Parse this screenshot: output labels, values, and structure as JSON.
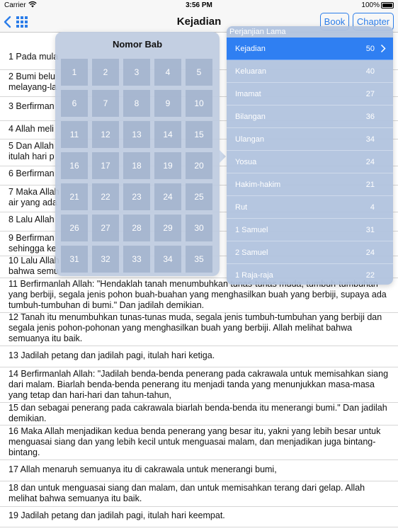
{
  "status": {
    "carrier": "Carrier",
    "time": "3:56 PM",
    "battery": "100%"
  },
  "nav": {
    "title": "Kejadian",
    "book_label": "Book",
    "chapter_label": "Chapter"
  },
  "verses": [
    {
      "text": "1 Pada mula"
    },
    {
      "text": "2 Bumi belu\nmelayang-la"
    },
    {
      "text": "3 Berfirman"
    },
    {
      "text": "4 Allah meli"
    },
    {
      "text": "5 Dan Allah\nitulah hari p"
    },
    {
      "text": "6 Berfirman"
    },
    {
      "text": "7 Maka Allah\nair yang ada"
    },
    {
      "text": "8 Lalu Allah"
    },
    {
      "text": "9 Berfirman\nsehingga ke"
    },
    {
      "text": "10 Lalu Allah\nbahwa semu"
    },
    {
      "text": "11 Berfirmanlah Allah: \"Hendaklah tanah menumbuhkan tunas-tunas muda, tumbuh-tumbuhan yang berbiji, segala jenis pohon buah-buahan yang menghasilkan buah yang berbiji, supaya ada tumbuh-tumbuhan di bumi.\" Dan jadilah demikian."
    },
    {
      "text": "12 Tanah itu menumbuhkan tunas-tunas muda, segala jenis tumbuh-tumbuhan yang berbiji dan segala jenis pohon-pohonan yang menghasilkan buah yang berbiji. Allah melihat bahwa semuanya itu baik."
    },
    {
      "text": "13 Jadilah petang dan jadilah pagi, itulah hari ketiga."
    },
    {
      "text": "14 Berfirmanlah Allah: \"Jadilah benda-benda penerang pada cakrawala untuk memisahkan siang dari malam. Biarlah benda-benda penerang itu menjadi tanda yang menunjukkan masa-masa yang tetap dan hari-hari dan tahun-tahun,"
    },
    {
      "text": "15 dan sebagai penerang pada cakrawala biarlah benda-benda itu menerangi bumi.\" Dan jadilah demikian."
    },
    {
      "text": "16 Maka Allah menjadikan kedua benda penerang yang besar itu, yakni yang lebih besar untuk menguasai siang dan yang lebih kecil untuk menguasai malam, dan menjadikan juga bintang-bintang."
    },
    {
      "text": "17 Allah menaruh semuanya itu di cakrawala untuk menerangi bumi,"
    },
    {
      "text": "18 dan untuk menguasai siang dan malam, dan untuk memisahkan terang dari gelap. Allah melihat bahwa semuanya itu baik."
    },
    {
      "text": "19 Jadilah petang dan jadilah pagi, itulah hari keempat."
    }
  ],
  "chapter_picker": {
    "title": "Nomor Bab",
    "chapters": [
      "1",
      "2",
      "3",
      "4",
      "5",
      "6",
      "7",
      "8",
      "9",
      "10",
      "11",
      "12",
      "13",
      "14",
      "15",
      "16",
      "17",
      "18",
      "19",
      "20",
      "21",
      "22",
      "23",
      "24",
      "25",
      "26",
      "27",
      "28",
      "29",
      "30",
      "31",
      "32",
      "33",
      "34",
      "35"
    ]
  },
  "book_picker": {
    "header": "Perjanjian Lama",
    "books": [
      {
        "name": "Kejadian",
        "chapters": "50",
        "selected": true
      },
      {
        "name": "Keluaran",
        "chapters": "40"
      },
      {
        "name": "Imamat",
        "chapters": "27"
      },
      {
        "name": "Bilangan",
        "chapters": "36"
      },
      {
        "name": "Ulangan",
        "chapters": "34"
      },
      {
        "name": "Yosua",
        "chapters": "24"
      },
      {
        "name": "Hakim-hakim",
        "chapters": "21"
      },
      {
        "name": "Rut",
        "chapters": "4"
      },
      {
        "name": "1 Samuel",
        "chapters": "31"
      },
      {
        "name": "2 Samuel",
        "chapters": "24"
      },
      {
        "name": "1 Raja-raja",
        "chapters": "22"
      }
    ]
  },
  "colors": {
    "accent": "#2b7de9",
    "selected_row": "#2f7ff2"
  }
}
